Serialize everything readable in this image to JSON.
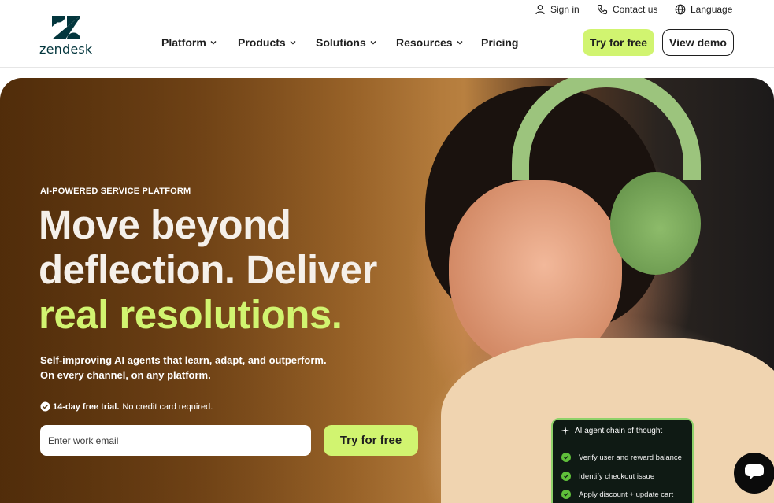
{
  "brand": {
    "name": "zendesk"
  },
  "utility": {
    "signin": "Sign in",
    "contact": "Contact us",
    "language": "Language"
  },
  "nav": {
    "items": [
      {
        "label": "Platform",
        "has_dropdown": true
      },
      {
        "label": "Products",
        "has_dropdown": true
      },
      {
        "label": "Solutions",
        "has_dropdown": true
      },
      {
        "label": "Resources",
        "has_dropdown": true
      },
      {
        "label": "Pricing",
        "has_dropdown": false
      }
    ],
    "try_label": "Try for free",
    "demo_label": "View demo"
  },
  "hero": {
    "eyebrow": "AI-POWERED SERVICE PLATFORM",
    "headline_line1": "Move beyond",
    "headline_line2": "deflection. Deliver",
    "headline_accent": "real resolutions.",
    "sub_line1": "Self-improving AI agents that learn, adapt, and outperform.",
    "sub_line2": "On every channel, on any platform.",
    "trial_bold": "14-day free trial.",
    "trial_rest": "No credit card required.",
    "email_placeholder": "Enter work email",
    "cta_label": "Try for free"
  },
  "ai_card": {
    "title": "AI agent chain of thought",
    "items": [
      "Verify user and reward balance",
      "Identify checkout issue",
      "Apply discount + update cart"
    ]
  },
  "colors": {
    "accent": "#d1f470",
    "brand_dark": "#03363d",
    "card_border": "#8fd16a"
  },
  "icons": [
    "person-icon",
    "phone-icon",
    "globe-icon",
    "chevron-down-icon",
    "check-circle-icon",
    "sparkle-icon",
    "chat-icon"
  ]
}
